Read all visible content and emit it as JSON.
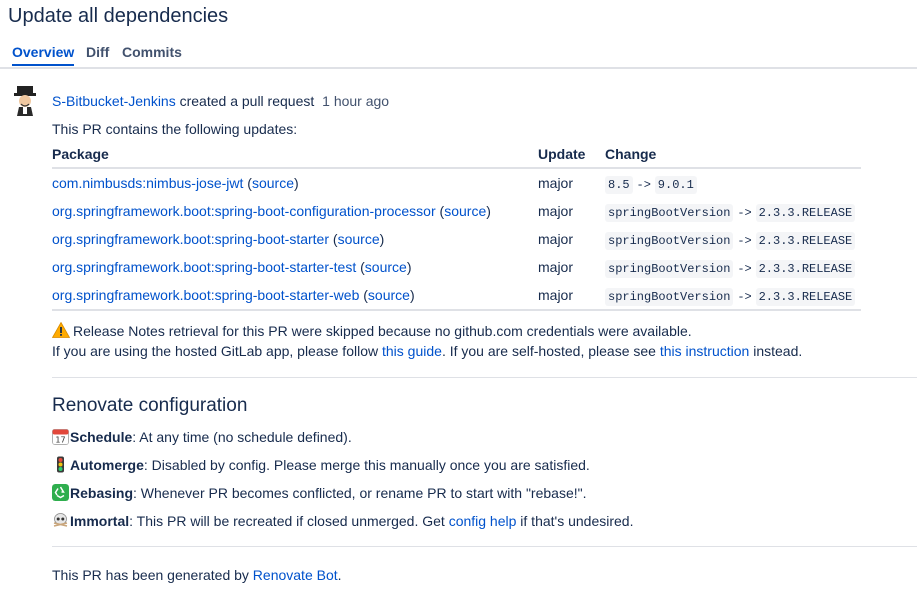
{
  "page": {
    "title": "Update all dependencies"
  },
  "tabs": [
    {
      "label": "Overview",
      "active": true
    },
    {
      "label": "Diff",
      "active": false
    },
    {
      "label": "Commits",
      "active": false
    }
  ],
  "activity": {
    "author": "S-Bitbucket-Jenkins",
    "action": "created a pull request",
    "time": "1 hour ago"
  },
  "intro": "This PR contains the following updates:",
  "table": {
    "headers": {
      "package": "Package",
      "update": "Update",
      "change": "Change"
    },
    "rows": [
      {
        "package": "com.nimbusds:nimbus-jose-jwt",
        "source": "source",
        "update": "major",
        "from": "8.5",
        "arrow": "->",
        "to": "9.0.1"
      },
      {
        "package": "org.springframework.boot:spring-boot-configuration-processor",
        "source": "source",
        "update": "major",
        "from": "springBootVersion",
        "arrow": "->",
        "to": "2.3.3.RELEASE"
      },
      {
        "package": "org.springframework.boot:spring-boot-starter",
        "source": "source",
        "update": "major",
        "from": "springBootVersion",
        "arrow": "->",
        "to": "2.3.3.RELEASE"
      },
      {
        "package": "org.springframework.boot:spring-boot-starter-test",
        "source": "source",
        "update": "major",
        "from": "springBootVersion",
        "arrow": "->",
        "to": "2.3.3.RELEASE"
      },
      {
        "package": "org.springframework.boot:spring-boot-starter-web",
        "source": "source",
        "update": "major",
        "from": "springBootVersion",
        "arrow": "->",
        "to": "2.3.3.RELEASE"
      }
    ]
  },
  "notice": {
    "line1": "Release Notes retrieval for this PR were skipped because no github.com credentials were available.",
    "line2_a": "If you are using the hosted GitLab app, please follow",
    "link1": "this guide",
    "line2_b": ". If you are self-hosted, please see",
    "link2": "this instruction",
    "line2_c": "instead."
  },
  "config": {
    "heading": "Renovate configuration",
    "schedule": {
      "label": "Schedule",
      "text": ": At any time (no schedule defined)."
    },
    "automerge": {
      "label": "Automerge",
      "text": ": Disabled by config. Please merge this manually once you are satisfied."
    },
    "rebasing": {
      "label": "Rebasing",
      "text": ": Whenever PR becomes conflicted, or rename PR to start with \"rebase!\"."
    },
    "immortal": {
      "label": "Immortal",
      "text_a": ": This PR will be recreated if closed unmerged. Get",
      "link": "config help",
      "text_b": "if that's undesired."
    }
  },
  "footer": {
    "text": "This PR has been generated by",
    "link": "Renovate Bot",
    "end": "."
  },
  "icons": {
    "warning": "warning-icon",
    "calendar": "calendar-icon",
    "traffic_light": "traffic-light-icon",
    "recycle": "recycle-icon",
    "ghost": "skull-icon"
  },
  "colors": {
    "link": "#0052cc",
    "text": "#172b4d",
    "warning": "#ffab00"
  }
}
